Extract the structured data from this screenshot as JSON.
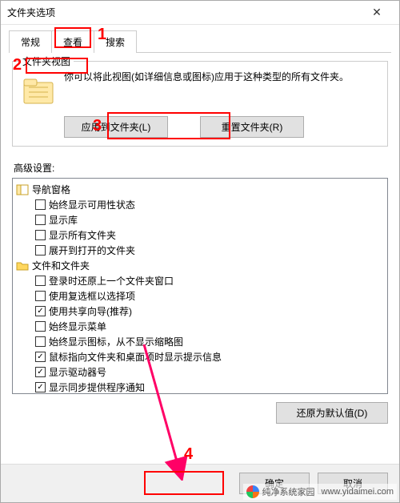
{
  "window": {
    "title": "文件夹选项",
    "close_glyph": "✕"
  },
  "tabs": {
    "general": "常规",
    "view": "查看",
    "search": "搜索"
  },
  "folder_view": {
    "legend": "文件夹视图",
    "desc": "你可以将此视图(如详细信息或图标)应用于这种类型的所有文件夹。",
    "apply_btn": "应用到文件夹(L)",
    "reset_btn": "重置文件夹(R)"
  },
  "advanced_label": "高级设置:",
  "tree": {
    "nav_pane": "导航窗格",
    "nav_items": [
      {
        "label": "始终显示可用性状态",
        "checked": false
      },
      {
        "label": "显示库",
        "checked": false
      },
      {
        "label": "显示所有文件夹",
        "checked": false
      },
      {
        "label": "展开到打开的文件夹",
        "checked": false
      }
    ],
    "files_folders": "文件和文件夹",
    "ff_items": [
      {
        "label": "登录时还原上一个文件夹窗口",
        "checked": false
      },
      {
        "label": "使用复选框以选择项",
        "checked": false
      },
      {
        "label": "使用共享向导(推荐)",
        "checked": true
      },
      {
        "label": "始终显示菜单",
        "checked": false
      },
      {
        "label": "始终显示图标，从不显示缩略图",
        "checked": false
      },
      {
        "label": "鼠标指向文件夹和桌面项时显示提示信息",
        "checked": true
      },
      {
        "label": "显示驱动器号",
        "checked": true
      },
      {
        "label": "显示同步提供程序通知",
        "checked": true
      }
    ]
  },
  "restore_defaults": "还原为默认值(D)",
  "buttons": {
    "ok": "确定",
    "cancel": "取消"
  },
  "annotations": {
    "n1": "1",
    "n2": "2",
    "n3": "3",
    "n4": "4"
  },
  "watermark": {
    "name": "纯净系统家园",
    "url": "www.yidaimei.com"
  }
}
